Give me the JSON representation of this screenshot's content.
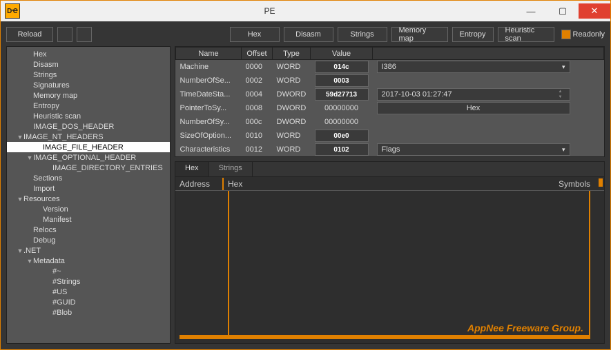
{
  "title": "PE",
  "icon_text": "DҼ",
  "toolbar": {
    "reload": "Reload",
    "hex": "Hex",
    "disasm": "Disasm",
    "strings": "Strings",
    "memmap": "Memory map",
    "entropy": "Entropy",
    "heuristic": "Heuristic scan",
    "readonly": "Readonly"
  },
  "tree": [
    {
      "indent": 1,
      "arrow": "",
      "label": "Hex"
    },
    {
      "indent": 1,
      "arrow": "",
      "label": "Disasm"
    },
    {
      "indent": 1,
      "arrow": "",
      "label": "Strings"
    },
    {
      "indent": 1,
      "arrow": "",
      "label": "Signatures"
    },
    {
      "indent": 1,
      "arrow": "",
      "label": "Memory map"
    },
    {
      "indent": 1,
      "arrow": "",
      "label": "Entropy"
    },
    {
      "indent": 1,
      "arrow": "",
      "label": "Heuristic scan"
    },
    {
      "indent": 1,
      "arrow": "",
      "label": "IMAGE_DOS_HEADER"
    },
    {
      "indent": 0,
      "arrow": "▼",
      "label": "IMAGE_NT_HEADERS"
    },
    {
      "indent": 2,
      "arrow": "",
      "label": "IMAGE_FILE_HEADER",
      "sel": true
    },
    {
      "indent": 1,
      "arrow": "▼",
      "label": "IMAGE_OPTIONAL_HEADER"
    },
    {
      "indent": 3,
      "arrow": "",
      "label": "IMAGE_DIRECTORY_ENTRIES"
    },
    {
      "indent": 1,
      "arrow": "",
      "label": "Sections"
    },
    {
      "indent": 1,
      "arrow": "",
      "label": "Import"
    },
    {
      "indent": 0,
      "arrow": "▼",
      "label": "Resources"
    },
    {
      "indent": 2,
      "arrow": "",
      "label": "Version"
    },
    {
      "indent": 2,
      "arrow": "",
      "label": "Manifest"
    },
    {
      "indent": 1,
      "arrow": "",
      "label": "Relocs"
    },
    {
      "indent": 1,
      "arrow": "",
      "label": "Debug"
    },
    {
      "indent": 0,
      "arrow": "▼",
      "label": ".NET"
    },
    {
      "indent": 1,
      "arrow": "▼",
      "label": "Metadata"
    },
    {
      "indent": 3,
      "arrow": "",
      "label": "#~"
    },
    {
      "indent": 3,
      "arrow": "",
      "label": "#Strings"
    },
    {
      "indent": 3,
      "arrow": "",
      "label": "#US"
    },
    {
      "indent": 3,
      "arrow": "",
      "label": "#GUID"
    },
    {
      "indent": 3,
      "arrow": "",
      "label": "#Blob"
    }
  ],
  "headers": {
    "name": "Name",
    "offset": "Offset",
    "type": "Type",
    "value": "Value"
  },
  "rows": [
    {
      "name": "Machine",
      "off": "0000",
      "type": "WORD",
      "val": "014c",
      "btn": true,
      "extra": {
        "kind": "dropdown",
        "text": "I386"
      }
    },
    {
      "name": "NumberOfSe...",
      "off": "0002",
      "type": "WORD",
      "val": "0003",
      "btn": true
    },
    {
      "name": "TimeDateSta...",
      "off": "0004",
      "type": "DWORD",
      "val": "59d27713",
      "btn": true,
      "extra": {
        "kind": "spin",
        "text": "2017-10-03 01:27:47"
      }
    },
    {
      "name": "PointerToSy...",
      "off": "0008",
      "type": "DWORD",
      "val": "00000000",
      "btn": false,
      "extra": {
        "kind": "hexbtn",
        "text": "Hex"
      }
    },
    {
      "name": "NumberOfSy...",
      "off": "000c",
      "type": "DWORD",
      "val": "00000000",
      "btn": false
    },
    {
      "name": "SizeOfOption...",
      "off": "0010",
      "type": "WORD",
      "val": "00e0",
      "btn": true
    },
    {
      "name": "Characteristics",
      "off": "0012",
      "type": "WORD",
      "val": "0102",
      "btn": true,
      "extra": {
        "kind": "dropdown",
        "text": "Flags"
      }
    }
  ],
  "hexTabs": {
    "hex": "Hex",
    "strings": "Strings"
  },
  "hexCols": {
    "addr": "Address",
    "hex": "Hex",
    "sym": "Symbols"
  },
  "watermark": "AppNee Freeware Group."
}
